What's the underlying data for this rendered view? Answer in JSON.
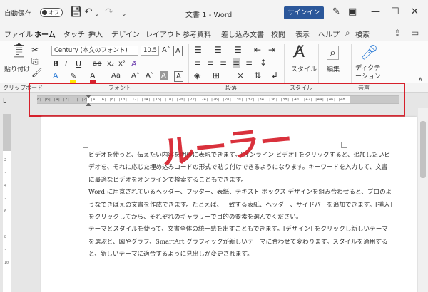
{
  "titlebar": {
    "autosave_label": "自動保存",
    "autosave_state": "オフ",
    "doc_title": "文書 1 - Word",
    "signin_label": "サインイン"
  },
  "tabs": [
    "ファイル",
    "ホーム",
    "タッチ",
    "挿入",
    "デザイン",
    "レイアウト",
    "参考資料",
    "差し込み文書",
    "校閲",
    "表示",
    "ヘルプ",
    "検索"
  ],
  "active_tab": "ホーム",
  "ribbon": {
    "paste_label": "貼り付け",
    "font_name": "Century (本文のフォント)",
    "font_size": "10.5",
    "style_label": "スタイル",
    "edit_label": "編集",
    "dictate_label": "ディクテーション",
    "groups": [
      "クリップボード",
      "フォント",
      "段落",
      "スタイル",
      "音声"
    ]
  },
  "ruler": {
    "corner": "L",
    "numbers": "8| |6| |4| |2| | | |2| |4| |6| |8| |10| |12| |14| |16| |18| |20| |22| |24| |26| |28| |30| |32| |34| |36| |38| |40| |42| |44| |46| |48"
  },
  "vruler": {
    "numbers": "2\n-\n4\n-\n6\n-\n8\n-\n10"
  },
  "annotation": {
    "text": "ルーラー",
    "color": "#d6202b"
  },
  "document": {
    "paragraphs": [
      "ビデオを使うと、伝えたい内容を明確に表現できます。[オンライン ビデオ] をクリックすると、追加したいビデオを、それに応じた埋め込みコードの形式で貼り付けできるようになります。キーワードを入力して、文書に最適なビデオをオンラインで検索することもできます。",
      "Word に用意されているヘッダー、フッター、表紙、テキスト ボックス デザインを組み合わせると、プロのようなできばえの文書を作成できます。たとえば、一致する表紙、ヘッダー、サイドバーを追加できます。[挿入] をクリックしてから、それぞれのギャラリーで目的の要素を選んでください。",
      "テーマとスタイルを使って、文書全体の統一感を出すこともできます。[デザイン] をクリックし新しいテーマを選ぶと、図やグラフ、SmartArt グラフィックが新しいテーマに合わせて変わります。スタイルを適用すると、新しいテーマに適合するように見出しが変更されます。"
    ]
  }
}
